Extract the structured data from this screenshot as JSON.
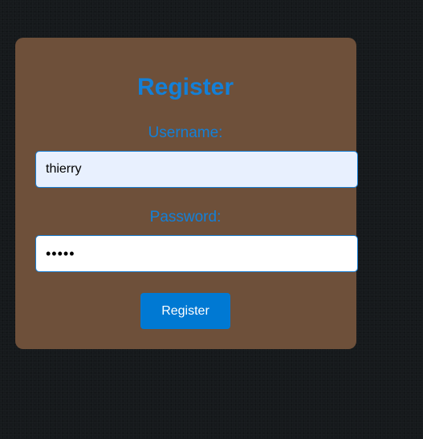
{
  "form": {
    "title": "Register",
    "username_label": "Username:",
    "username_value": "thierry",
    "password_label": "Password:",
    "password_value": "hello",
    "submit_label": "Register"
  },
  "colors": {
    "page_background": "#16191c",
    "card_background": "#6e503a",
    "accent": "#1380d8",
    "button": "#0079d3",
    "autofill_field": "#e8f0fe"
  }
}
